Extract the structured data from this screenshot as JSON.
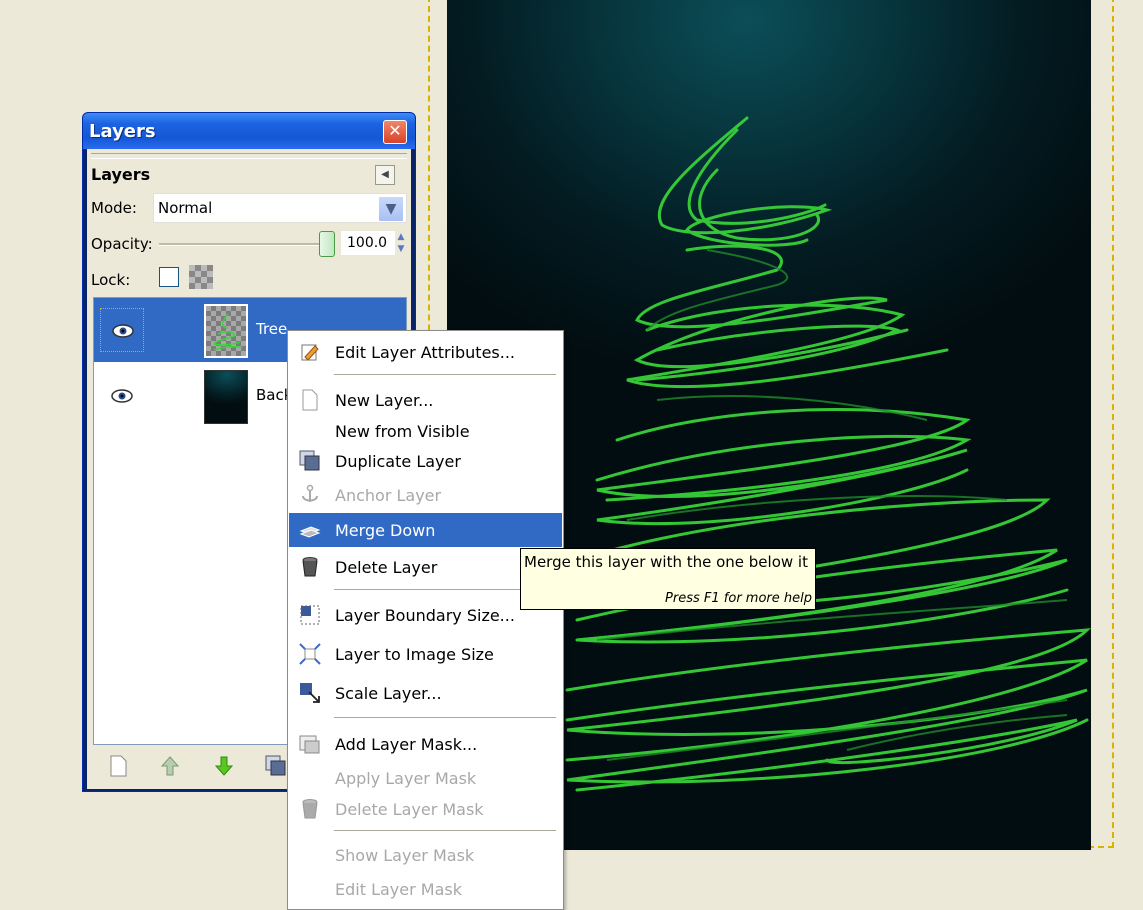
{
  "layers_window": {
    "title": "Layers",
    "dock_title": "Layers",
    "mode_label": "Mode:",
    "mode_value": "Normal",
    "opacity_label": "Opacity:",
    "opacity_value": "100.0",
    "opacity_fraction": 1.0,
    "lock_label": "Lock:",
    "layers": [
      {
        "name": "Tree",
        "visible": true,
        "selected": true
      },
      {
        "name": "Background",
        "visible": true,
        "selected": false
      }
    ]
  },
  "context_menu": {
    "items": [
      {
        "label": "Edit Layer Attributes...",
        "enabled": true
      },
      {
        "label": "New Layer...",
        "enabled": true
      },
      {
        "label": "New from Visible",
        "enabled": true
      },
      {
        "label": "Duplicate Layer",
        "enabled": true
      },
      {
        "label": "Anchor Layer",
        "enabled": false
      },
      {
        "label": "Merge Down",
        "enabled": true,
        "highlighted": true
      },
      {
        "label": "Delete Layer",
        "enabled": true
      },
      {
        "label": "Layer Boundary Size...",
        "enabled": true
      },
      {
        "label": "Layer to Image Size",
        "enabled": true
      },
      {
        "label": "Scale Layer...",
        "enabled": true
      },
      {
        "label": "Add Layer Mask...",
        "enabled": true
      },
      {
        "label": "Apply Layer Mask",
        "enabled": false
      },
      {
        "label": "Delete Layer Mask",
        "enabled": false
      },
      {
        "label": "Show Layer Mask",
        "enabled": false
      },
      {
        "label": "Edit Layer Mask",
        "enabled": false
      }
    ]
  },
  "tooltip": {
    "text": "Merge this layer with the one below it",
    "help": "Press F1 for more help"
  },
  "colors": {
    "selection": "#316ac5",
    "tree_stroke": "#3cd43c",
    "canvas_dark": "#031c22"
  }
}
